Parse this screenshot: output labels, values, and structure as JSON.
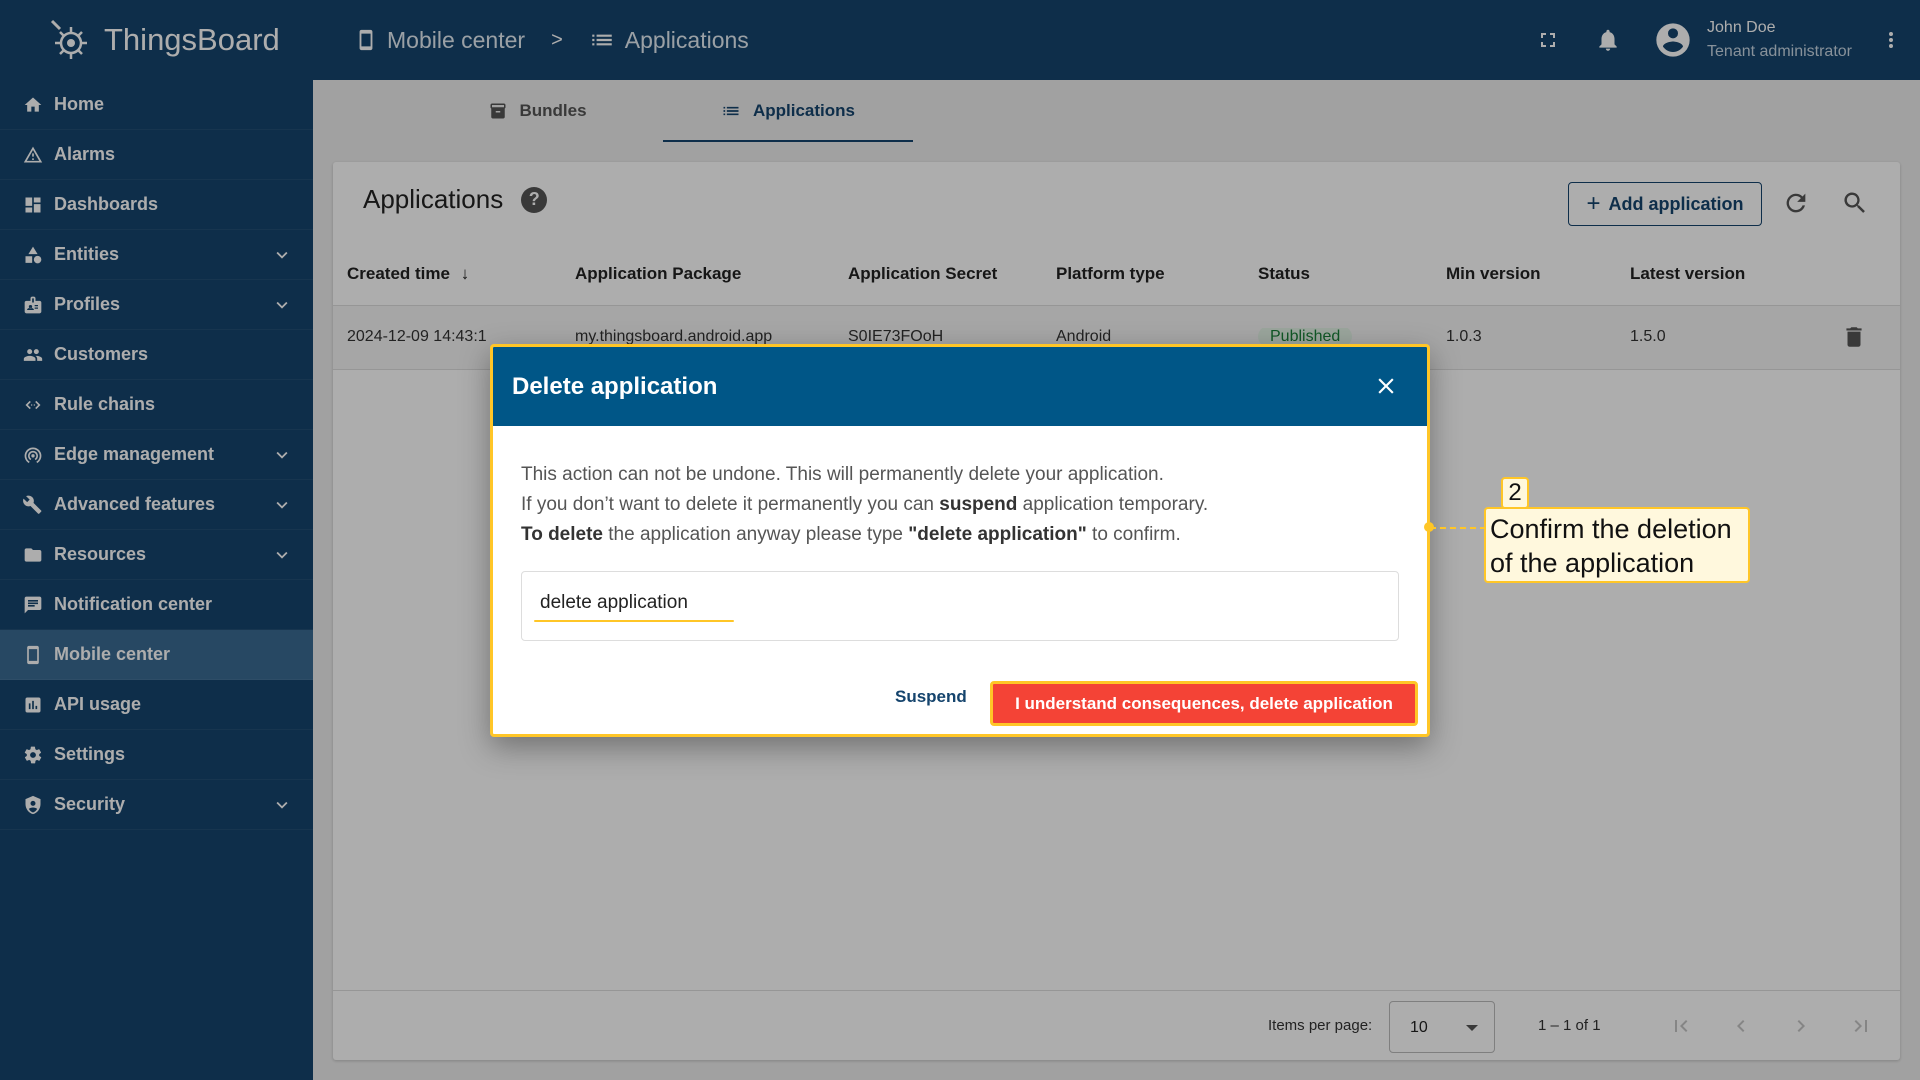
{
  "app": {
    "name": "ThingsBoard"
  },
  "sidebar": {
    "items": [
      {
        "label": "Home"
      },
      {
        "label": "Alarms"
      },
      {
        "label": "Dashboards"
      },
      {
        "label": "Entities"
      },
      {
        "label": "Profiles"
      },
      {
        "label": "Customers"
      },
      {
        "label": "Rule chains"
      },
      {
        "label": "Edge management"
      },
      {
        "label": "Advanced features"
      },
      {
        "label": "Resources"
      },
      {
        "label": "Notification center"
      },
      {
        "label": "Mobile center"
      },
      {
        "label": "API usage"
      },
      {
        "label": "Settings"
      },
      {
        "label": "Security"
      }
    ]
  },
  "header": {
    "breadcrumb": [
      "Mobile center",
      "Applications"
    ],
    "separator": ">",
    "user": {
      "name": "John Doe",
      "role": "Tenant administrator"
    }
  },
  "tabs": [
    "Bundles",
    "Applications"
  ],
  "card": {
    "title": "Applications",
    "help": "?",
    "add_button": "Add application"
  },
  "table": {
    "columns": [
      "Created time",
      "Application Package",
      "Application Secret",
      "Platform type",
      "Status",
      "Min version",
      "Latest version"
    ],
    "rows": [
      [
        "2024-12-09 14:43:1",
        "my.thingsboard.android.app",
        "S0IE73FOoH",
        "Android",
        "Published",
        "1.0.3",
        "1.5.0"
      ]
    ]
  },
  "pagination": {
    "items_per_page_label": "Items per page:",
    "items_per_page": "10",
    "range": "1 – 1 of 1"
  },
  "dialog": {
    "title": "Delete application",
    "line1": "This action can not be undone. This will permanently delete your application.",
    "line2_pre": "If you don’t want to delete it permanently you can ",
    "line2_bold": "suspend",
    "line2_post": " application temporary.",
    "line3_bold1": "To delete",
    "line3_mid": " the application anyway please type ",
    "line3_bold2": "\"delete application\"",
    "line3_post": " to confirm.",
    "input_value": "delete application",
    "suspend_label": "Suspend",
    "delete_label": "I understand consequences, delete application"
  },
  "callout": {
    "number": "2",
    "line1": "Confirm the deletion",
    "line2": "of the application"
  },
  "colors": {
    "primary": "#15446d",
    "dialog_header": "#005687",
    "danger": "#f44336",
    "highlight": "#ffc627"
  }
}
